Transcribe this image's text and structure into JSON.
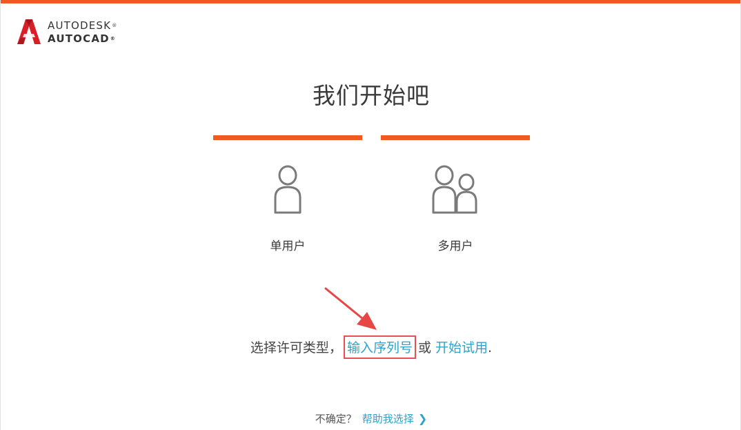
{
  "header": {
    "brand": "AUTODESK",
    "product": "AUTOCAD",
    "registered_mark": "®",
    "accent_color": "#f05a22"
  },
  "title": "我们开始吧",
  "options": [
    {
      "label": "单用户",
      "icon": "single-user-icon"
    },
    {
      "label": "多用户",
      "icon": "multi-user-icon"
    }
  ],
  "license": {
    "prefix": "选择许可类型，",
    "serial_link": "输入序列号",
    "or_text": "或",
    "trial_link": "开始试用",
    "suffix": ".",
    "link_color": "#2ea3c9",
    "highlight_color": "#e85050"
  },
  "help": {
    "question": "不确定？",
    "link": "帮助我选择",
    "chevron": "❯"
  }
}
